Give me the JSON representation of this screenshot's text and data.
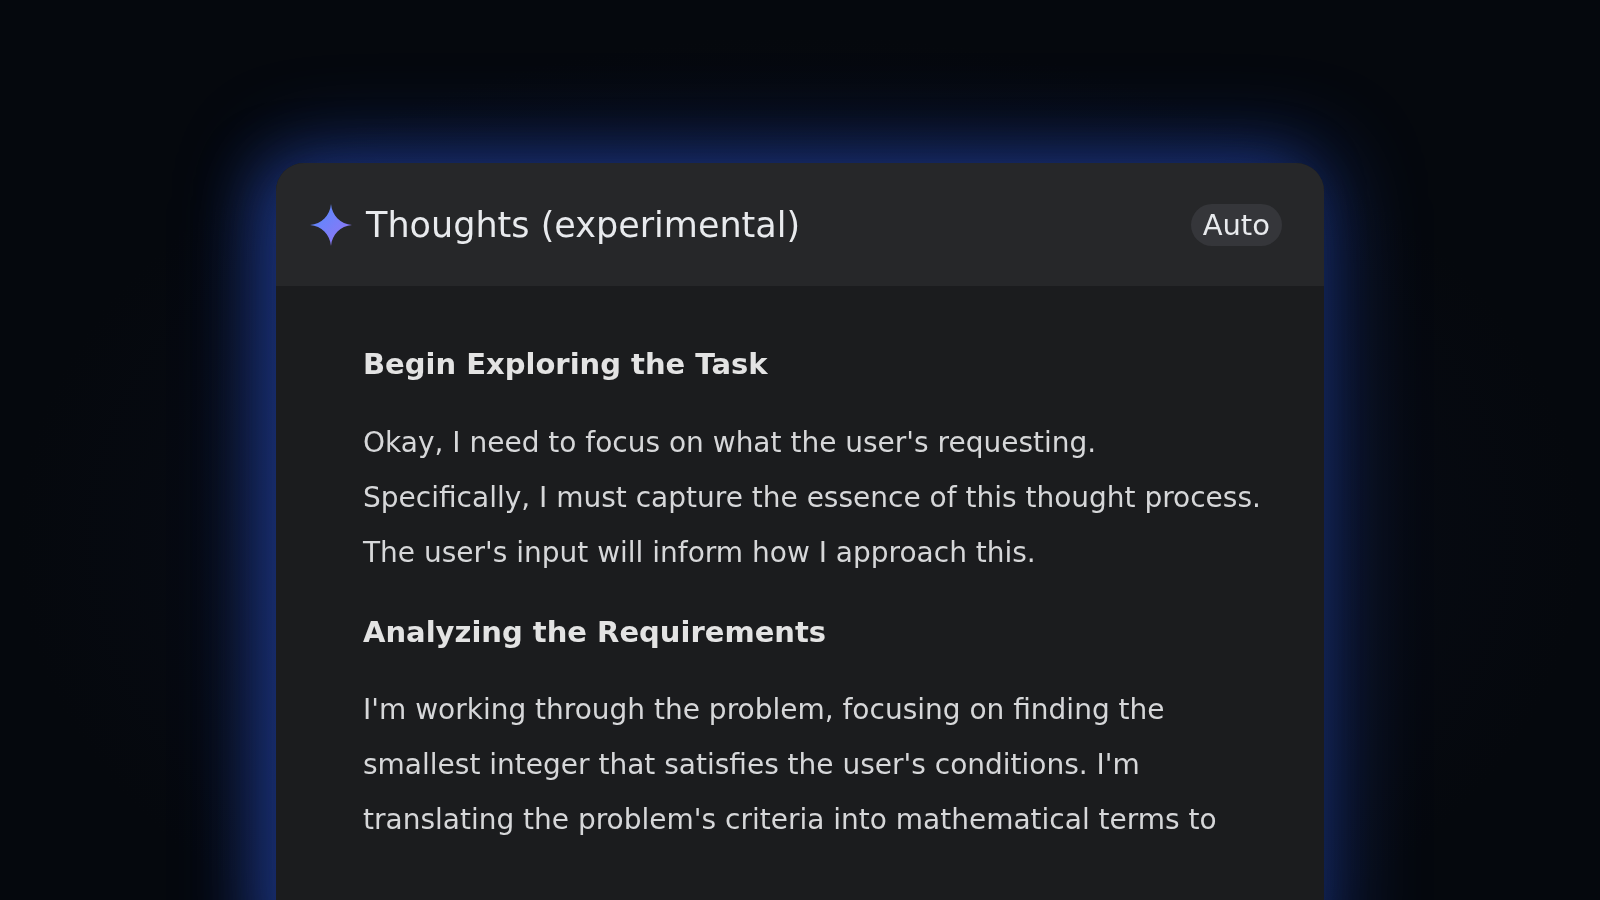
{
  "panel": {
    "title": "Thoughts (experimental)",
    "mode_badge": "Auto"
  },
  "sections": [
    {
      "heading": "Begin Exploring the Task",
      "body": "Okay, I need to focus on what the user's requesting. Specifically, I must capture the essence of this thought process. The user's input will inform how I approach this."
    },
    {
      "heading": "Analyzing the Requirements",
      "body": "I'm working through the problem, focusing on finding the smallest integer that satisfies the user's conditions. I'm translating the problem's criteria into mathematical terms to"
    }
  ]
}
